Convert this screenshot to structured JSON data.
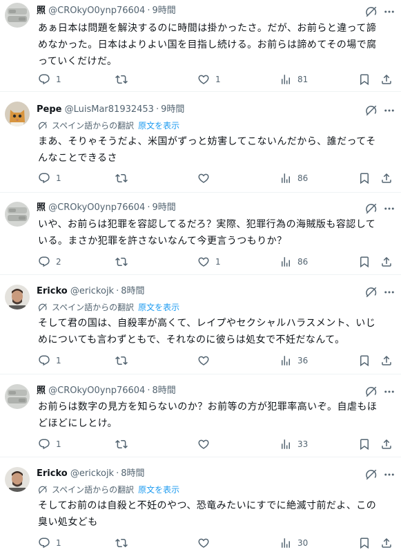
{
  "translate": {
    "note": "スペイン語からの翻訳",
    "show_original": "原文を表示"
  },
  "tweets": [
    {
      "name": "照",
      "handle": "@CROkyO0ynp76604",
      "time": "9時間",
      "lines": [
        "あぁ日本は問題を解決するのに時間は掛かったさ。だが、お前らと違って諦",
        "めなかった。日本はよりよい国を目指し続ける。お前らは諦めてその場で腐",
        "っていくだけだ。"
      ],
      "replies": "1",
      "retweets": "",
      "likes": "1",
      "views": "81"
    },
    {
      "name": "Pepe",
      "handle": "@LuisMar81932453",
      "time": "9時間",
      "lines": [
        "まあ、そりゃそうだよ、米国がずっと妨害してこないんだから、誰だってそ",
        "んなことできるさ"
      ],
      "replies": "1",
      "retweets": "",
      "likes": "",
      "views": "86"
    },
    {
      "name": "照",
      "handle": "@CROkyO0ynp76604",
      "time": "9時間",
      "lines": [
        "いや、お前らは犯罪を容認してるだろ？実際、犯罪行為の海賊版も容認して",
        "いる。まさか犯罪を許さないなんて今更言うつもりか？"
      ],
      "replies": "2",
      "retweets": "",
      "likes": "1",
      "views": "86"
    },
    {
      "name": "Ericko",
      "handle": "@erickojk",
      "time": "8時間",
      "lines": [
        "そして君の国は、自殺率が高くて、レイプやセクシャルハラスメント、いじ",
        "めについても言わずともで、それなのに彼らは処女で不妊だなんて。"
      ],
      "replies": "1",
      "retweets": "",
      "likes": "",
      "views": "36"
    },
    {
      "name": "照",
      "handle": "@CROkyO0ynp76604",
      "time": "8時間",
      "lines": [
        "お前らは数字の見方を知らないのか？お前等の方が犯罪率高いぞ。自虐もほ",
        "どほどにしとけ。"
      ],
      "replies": "1",
      "retweets": "",
      "likes": "",
      "views": "33"
    },
    {
      "name": "Ericko",
      "handle": "@erickojk",
      "time": "8時間",
      "lines": [
        "そしてお前のは自殺と不妊のやつ、恐竜みたいにすでに絶滅寸前だよ、この",
        "臭い処女ども"
      ],
      "replies": "1",
      "retweets": "",
      "likes": "",
      "views": "30"
    }
  ],
  "icons": {
    "reply": "reply-icon",
    "retweet": "retweet-icon",
    "like": "heart-icon",
    "views": "views-icon",
    "bookmark": "bookmark-icon",
    "share": "share-icon",
    "grok": "grok-icon",
    "more": "more-icon",
    "translate": "translate-icon"
  },
  "colors": {
    "text": "#0f1419",
    "secondary": "#536471",
    "link": "#1d9bf0",
    "divider": "#eff3f4"
  }
}
